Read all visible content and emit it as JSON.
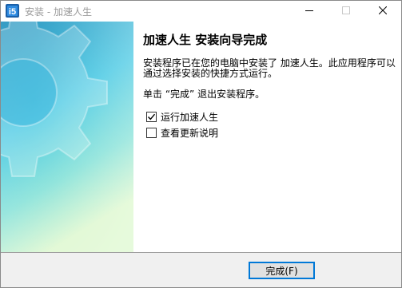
{
  "window": {
    "title": "安装 - 加速人生",
    "minimize_icon": "minimize-icon",
    "maximize_icon": "maximize-icon",
    "close_icon": "close-icon"
  },
  "side_panel": {
    "art": "gear-icon",
    "gradient_colors": [
      "#0f88b8",
      "#3fc6e2",
      "#7fe0d6",
      "#d9f7c9"
    ]
  },
  "content": {
    "heading": "加速人生  安装向导完成",
    "description": "安装程序已在您的电脑中安装了 加速人生。此应用程序可以通过选择安装的快捷方式运行。",
    "hint": "单击 “完成” 退出安装程序。",
    "options": [
      {
        "label": "运行加速人生",
        "checked": true
      },
      {
        "label": "查看更新说明",
        "checked": false
      }
    ]
  },
  "footer": {
    "finish_label": "完成(F)",
    "accent_color": "#0078d7"
  }
}
